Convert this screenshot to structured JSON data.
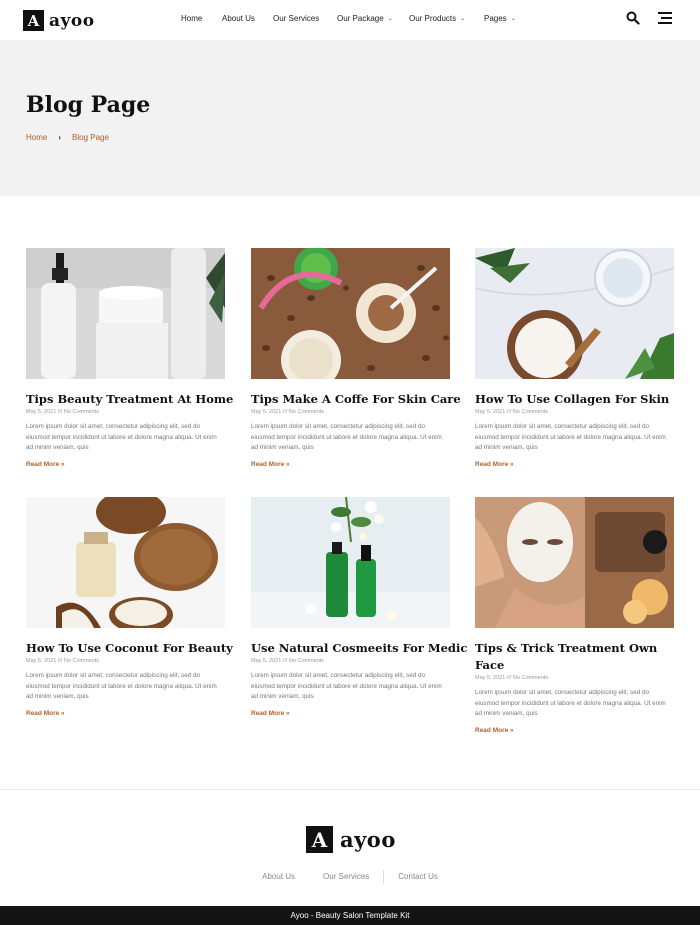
{
  "header": {
    "logo_letter": "A",
    "logo_text": "ayoo",
    "nav": [
      {
        "label": "Home",
        "caret": false
      },
      {
        "label": "About Us",
        "caret": false
      },
      {
        "label": "Our Services",
        "caret": false
      },
      {
        "label": "Our Package",
        "caret": true
      },
      {
        "label": "Our Products",
        "caret": true
      },
      {
        "label": "Pages",
        "caret": true
      }
    ],
    "icons": [
      "search-icon",
      "menu-icon"
    ]
  },
  "banner": {
    "title": "Blog Page",
    "breadcrumb": [
      "Home",
      "Blog Page"
    ]
  },
  "posts": [
    {
      "title": "Tips Beauty Treatment At Home",
      "meta": "May 5, 2021 /// No Comments",
      "excerpt": "Lorem ipsum dolor sit amet, consectetur adipiscing elit, sed do eiusmod tempor incididunt ut labore et dolore magna aliqua. Ut enim ad minim veniam, quis",
      "more": "Read More »"
    },
    {
      "title": "Tips Make A Coffe For Skin Care",
      "meta": "May 5, 2021 /// No Comments",
      "excerpt": "Lorem ipsum dolor sit amet, consectetur adipiscing elit, sed do eiusmod tempor incididunt ut labore et dolore magna aliqua. Ut enim ad minim veniam, quis",
      "more": "Read More »"
    },
    {
      "title": "How To Use Collagen For Skin",
      "meta": "May 5, 2021 /// No Comments",
      "excerpt": "Lorem ipsum dolor sit amet, consectetur adipiscing elit, sed do eiusmod tempor incididunt ut labore et dolore magna aliqua. Ut enim ad minim veniam, quis",
      "more": "Read More »"
    },
    {
      "title": "How To Use Coconut For Beauty",
      "meta": "May 5, 2021 /// No Comments",
      "excerpt": "Lorem ipsum dolor sit amet, consectetur adipiscing elit, sed do eiusmod tempor incididunt ut labore et dolore magna aliqua. Ut enim ad minim veniam, quis",
      "more": "Read More »"
    },
    {
      "title": "Use Natural Cosmeeits For Medic",
      "meta": "May 5, 2021 /// No Comments",
      "excerpt": "Lorem ipsum dolor sit amet, consectetur adipiscing elit, sed do eiusmod tempor incididunt ut labore et dolore magna aliqua. Ut enim ad minim veniam, quis",
      "more": "Read More »"
    },
    {
      "title": "Tips & Trick Treatment Own Face",
      "meta": "May 5, 2021 /// No Comments",
      "excerpt": "Lorem ipsum dolor sit amet, consectetur adipiscing elit, sed do eiusmod tempor incididunt ut labore et dolore magna aliqua. Ut enim ad minim veniam, quis",
      "more": "Read More »"
    }
  ],
  "footer": {
    "logo_letter": "A",
    "logo_text": "ayoo",
    "links": [
      "About Us",
      "Our Services",
      "Contact Us"
    ],
    "copyright": "Ayoo - Beauty Salon Template Kit"
  },
  "colors": {
    "accent": "#b5602c",
    "banner_bg": "#f2f2f2",
    "footer_bar": "#141414"
  }
}
